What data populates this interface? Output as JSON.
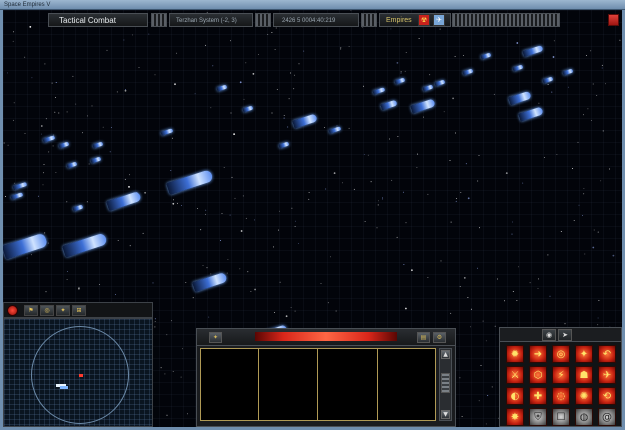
{
  "window": {
    "title": "Space Empires V"
  },
  "hud": {
    "mode_title": "Tactical Combat",
    "location": "Terzhan System (-2, 3)",
    "stardate": "2426 5 0004:40:219",
    "empire_label": "Empires",
    "flag_red_icon": "empire-flag-icon",
    "flag_blue_icon": "allied-flag-icon",
    "close_icon": "close-icon"
  },
  "minimap_tabs": [
    {
      "name": "record-button",
      "icon": "record-icon",
      "label": ""
    },
    {
      "name": "ship-filter-button",
      "icon": "ships-icon",
      "label": "⚑"
    },
    {
      "name": "planet-filter-button",
      "icon": "planet-icon",
      "label": "◎"
    },
    {
      "name": "fleet-filter-button",
      "icon": "fleet-icon",
      "label": "✦"
    },
    {
      "name": "zoom-button",
      "icon": "zoom-icon",
      "label": "⊞"
    }
  ],
  "center_panel": {
    "left_icon": "weapon-icon",
    "right_icons": [
      "log-icon",
      "settings-icon"
    ],
    "scroll_up": "▲",
    "scroll_down": "▼"
  },
  "order_tabs": [
    {
      "name": "tab-orders",
      "label": "◉"
    },
    {
      "name": "tab-cursor",
      "label": "➤"
    }
  ],
  "order_buttons": [
    {
      "name": "attack-order-button",
      "icon": "attack-icon",
      "glyph": "✹",
      "style": "red"
    },
    {
      "name": "move-order-button",
      "icon": "move-icon",
      "glyph": "➜",
      "style": "red"
    },
    {
      "name": "target-order-button",
      "icon": "target-icon",
      "glyph": "◎",
      "style": "red"
    },
    {
      "name": "fire-order-button",
      "icon": "fire-icon",
      "glyph": "✦",
      "style": "red"
    },
    {
      "name": "retreat-order-button",
      "icon": "retreat-icon",
      "glyph": "↶",
      "style": "red"
    },
    {
      "name": "guard-order-button",
      "icon": "guard-icon",
      "glyph": "⚔",
      "style": "red"
    },
    {
      "name": "formation-order-button",
      "icon": "formation-icon",
      "glyph": "⬡",
      "style": "red"
    },
    {
      "name": "ram-order-button",
      "icon": "ram-icon",
      "glyph": "⚡",
      "style": "red"
    },
    {
      "name": "boarding-order-button",
      "icon": "boarding-icon",
      "glyph": "☗",
      "style": "red"
    },
    {
      "name": "launch-order-button",
      "icon": "launch-icon",
      "glyph": "✈",
      "style": "red"
    },
    {
      "name": "cloak-order-button",
      "icon": "cloak-icon",
      "glyph": "◐",
      "style": "red"
    },
    {
      "name": "repair-order-button",
      "icon": "repair-icon",
      "glyph": "✚",
      "style": "red"
    },
    {
      "name": "scan-order-button",
      "icon": "scan-icon",
      "glyph": "◌",
      "style": "red"
    },
    {
      "name": "mine-order-button",
      "icon": "mine-icon",
      "glyph": "✺",
      "style": "red"
    },
    {
      "name": "tractor-order-button",
      "icon": "tractor-icon",
      "glyph": "⟲",
      "style": "red"
    },
    {
      "name": "self-destruct-order-button",
      "icon": "explosion-icon",
      "glyph": "✸",
      "style": "red"
    },
    {
      "name": "shield-order-button",
      "icon": "shield-icon",
      "glyph": "⛨",
      "style": "grey"
    },
    {
      "name": "capture-order-button",
      "icon": "capture-icon",
      "glyph": "☐",
      "style": "grey"
    },
    {
      "name": "warp-order-button",
      "icon": "warp-icon",
      "glyph": "◍",
      "style": "grey"
    },
    {
      "name": "end-turn-button",
      "icon": "spiral-icon",
      "glyph": "@",
      "style": "grey"
    }
  ],
  "colors": {
    "accent_red": "#d9261a",
    "panel_gold": "#b09a55",
    "hud_text": "#cfd6dd"
  }
}
